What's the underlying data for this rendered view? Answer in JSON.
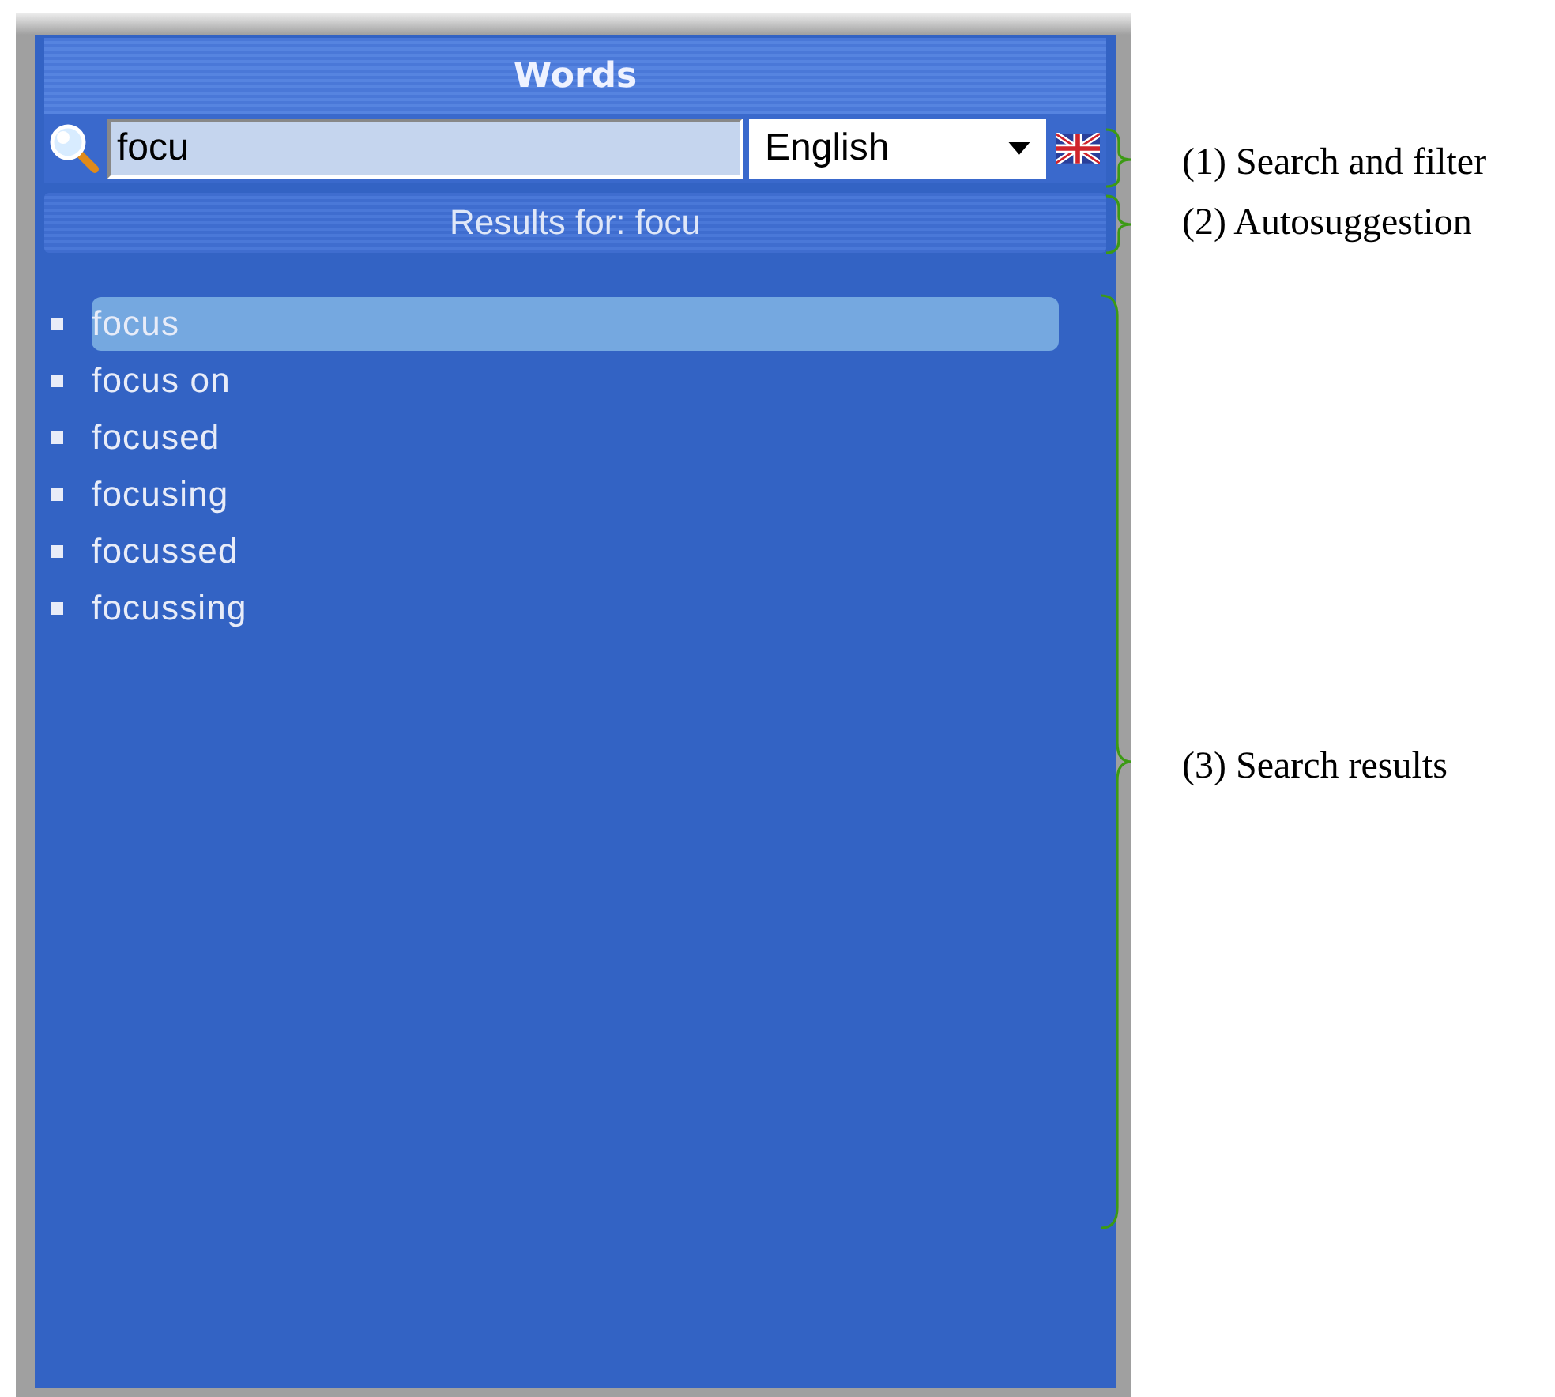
{
  "panel": {
    "title": "Words",
    "search": {
      "value": "focu"
    },
    "language": {
      "value": "English"
    },
    "results_header": "Results for: focu",
    "results": [
      {
        "text": "focus",
        "selected": true
      },
      {
        "text": "focus on",
        "selected": false
      },
      {
        "text": "focused",
        "selected": false
      },
      {
        "text": "focusing",
        "selected": false
      },
      {
        "text": "focussed",
        "selected": false
      },
      {
        "text": "focussing",
        "selected": false
      }
    ]
  },
  "annotations": [
    {
      "label": "(1) Search and filter"
    },
    {
      "label": "(2) Autosuggestion"
    },
    {
      "label": "(3) Search results"
    }
  ]
}
